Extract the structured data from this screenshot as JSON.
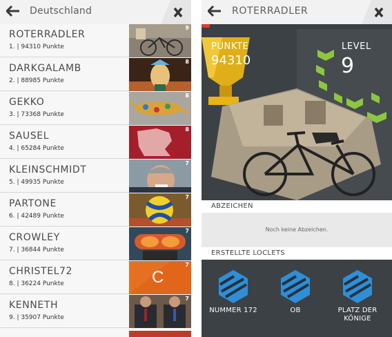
{
  "leaderboard": {
    "title": "Deutschland",
    "rows": [
      {
        "name": "ROTERRADLER",
        "score": "1. | 94310 Punkte",
        "level": "9"
      },
      {
        "name": "DARKGALAMB",
        "score": "2. | 88985 Punkte",
        "level": "8"
      },
      {
        "name": "GEKKO",
        "score": "3. | 73368 Punkte",
        "level": "8"
      },
      {
        "name": "SAUSEL",
        "score": "4. | 65284 Punkte",
        "level": "8"
      },
      {
        "name": "KLEINSCHMIDT",
        "score": "5. | 49935 Punkte",
        "level": "7"
      },
      {
        "name": "PARTONE",
        "score": "6. | 42489 Punkte",
        "level": "7"
      },
      {
        "name": "CROWLEY",
        "score": "7. | 36844 Punkte",
        "level": "7"
      },
      {
        "name": "CHRISTEL72",
        "score": "8. | 36224 Punkte",
        "level": "7",
        "letter": "C"
      },
      {
        "name": "KENNETH",
        "score": "9. | 35907 Punkte",
        "level": "7"
      }
    ]
  },
  "profile": {
    "title": "ROTERRADLER",
    "points_label": "PUNKTE",
    "points_value": "94310",
    "level_label": "LEVEL",
    "level_value": "9",
    "badges_header": "ABZEICHEN",
    "badges_empty": "Noch keine Abzeichen.",
    "loclets_header": "ERSTELLTE LOCLETS",
    "loclets": [
      {
        "label": "NUMMER 172"
      },
      {
        "label": "OB"
      },
      {
        "label": "PLATZ DER\nKÖNIGE"
      }
    ]
  },
  "colors": {
    "accent_red": "#e23b2e",
    "trophy_yellow": "#e8b416",
    "level_green": "#8dc63f",
    "hex_blue": "#2f8fd6",
    "dark_panel": "#3c4146"
  },
  "icons": [
    "back-arrow-icon",
    "close-x-icon",
    "trophy-icon",
    "level-chevron-icon",
    "hexagon-icon"
  ]
}
